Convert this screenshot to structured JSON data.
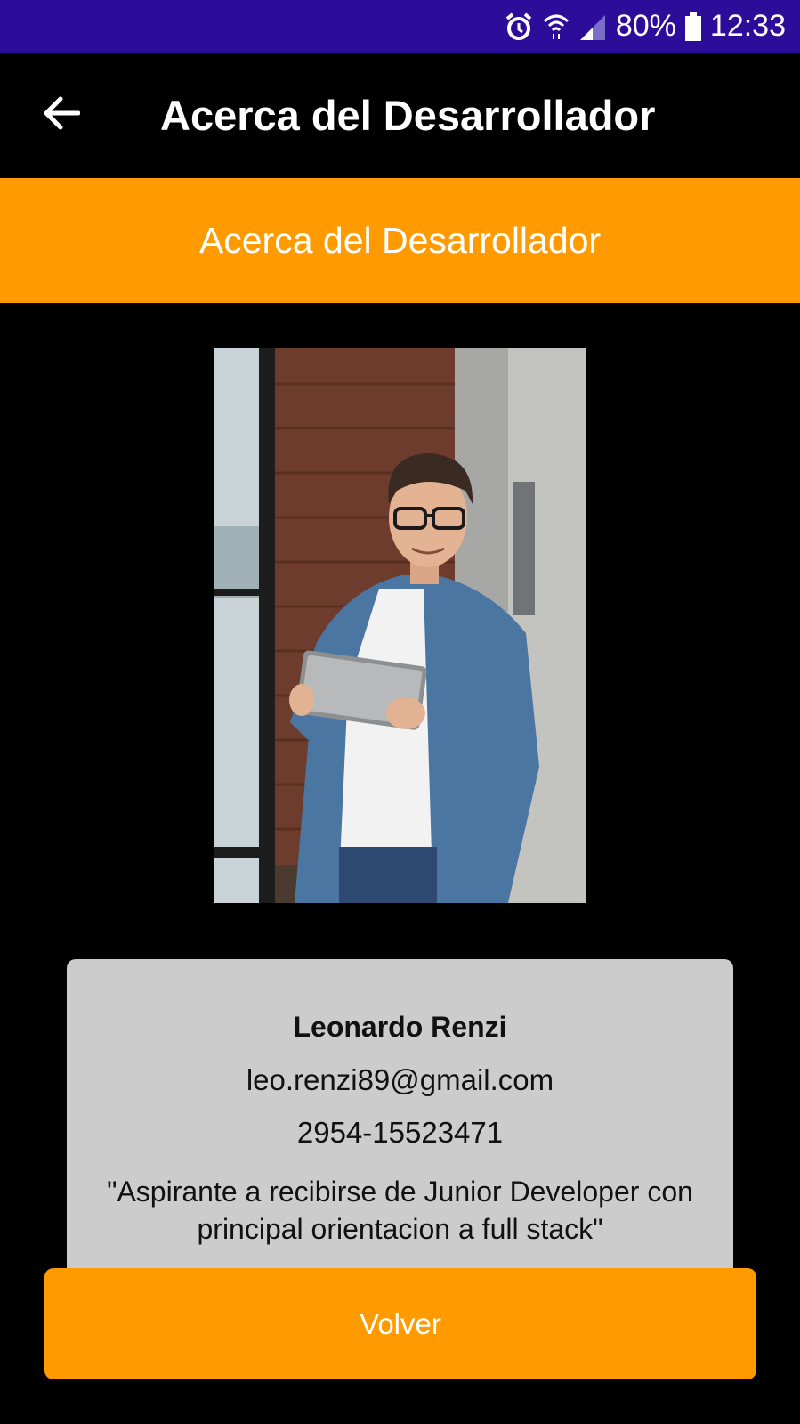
{
  "status_bar": {
    "battery": "80%",
    "time": "12:33",
    "icons": [
      "alarm-icon",
      "wifi-icon",
      "signal-icon",
      "battery-icon"
    ],
    "background": "#2c0d99"
  },
  "app_bar": {
    "title": "Acerca del Desarrollador",
    "back_icon": "arrow-left-icon"
  },
  "banner": {
    "text": "Acerca del Desarrollador",
    "color": "#ff9a00"
  },
  "developer": {
    "photo_icon": "developer-photo",
    "name": "Leonardo Renzi",
    "email": "leo.renzi89@gmail.com",
    "phone": "2954-15523471",
    "quote": "\"Aspirante a recibirse de Junior Developer con principal orientacion a full stack\""
  },
  "actions": {
    "back_label": "Volver",
    "color": "#ff9a00"
  }
}
